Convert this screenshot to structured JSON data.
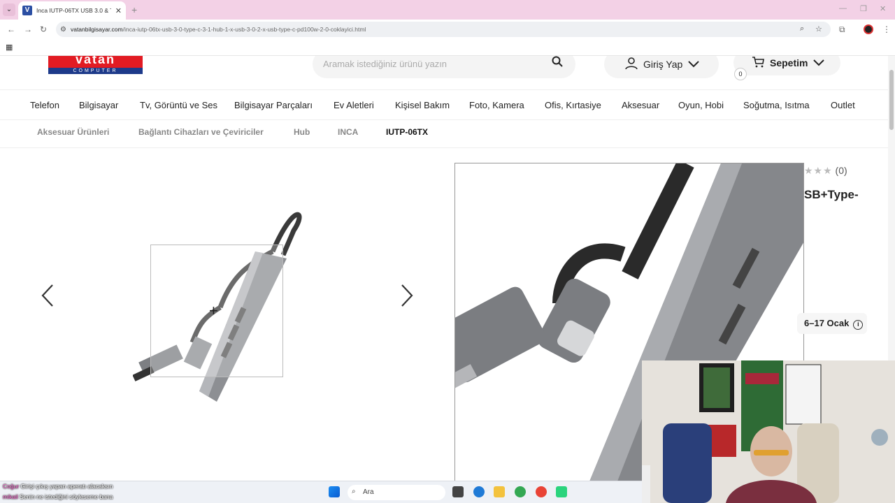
{
  "browser": {
    "tab_title": "Inca IUTP-06TX USB 3.0 & Type",
    "url_domain": "vatanbilgisayar.com",
    "url_path": "/inca-iutp-06tx-usb-3-0-type-c-3-1-hub-1-x-usb-3-0-2-x-usb-type-c-pd100w-2-0-coklayici.html"
  },
  "header": {
    "logo_text": "vatan",
    "logo_sub": "COMPUTER",
    "search_placeholder": "Aramak istediğiniz ürünü yazın",
    "login_label": "Giriş Yap",
    "cart_label": "Sepetim",
    "cart_count": "0"
  },
  "categories": [
    "Telefon",
    "Bilgisayar",
    "Tv, Görüntü ve Ses",
    "Bilgisayar Parçaları",
    "Ev Aletleri",
    "Kişisel Bakım",
    "Foto, Kamera",
    "Ofis, Kırtasiye",
    "Aksesuar",
    "Oyun, Hobi",
    "Soğutma, Isıtma",
    "Outlet"
  ],
  "breadcrumb": [
    "Aksesuar Ürünleri",
    "Bağlantı Cihazları ve Çeviriciler",
    "Hub",
    "INCA",
    "IUTP-06TX"
  ],
  "product": {
    "rating_count": "(0)",
    "title_fragment": "SB+Type-",
    "delivery": "6–17 Ocak",
    "rating_stars": 0
  },
  "taskbar": {
    "search_label": "Ara"
  },
  "chat": [
    {
      "user": "Coğur",
      "text": "Girişi çıkış yapan aperatı alacaksın"
    },
    {
      "user": "mikail",
      "text": "Senin ne istediğini söyleseme bana"
    }
  ],
  "colors": {
    "brand_red": "#e21b23",
    "brand_blue": "#1d3a8a",
    "tab_strip": "#f3d1e6"
  }
}
